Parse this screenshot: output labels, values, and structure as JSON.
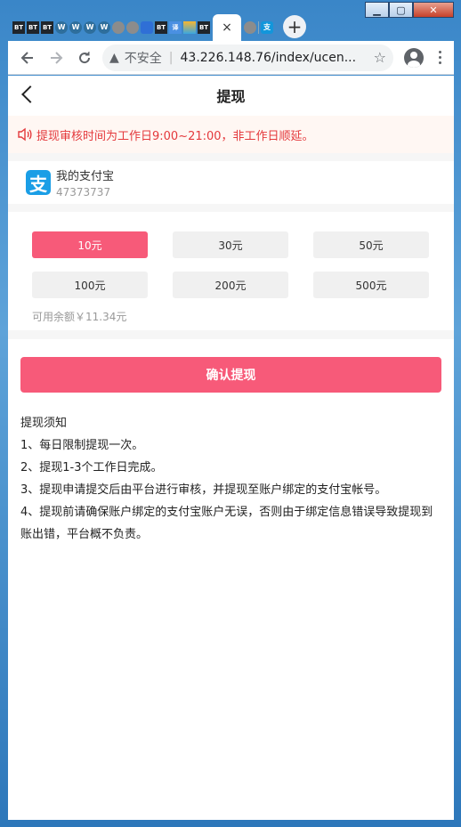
{
  "window": {
    "minimize_glyph": "▁",
    "maximize_glyph": "▢",
    "close_glyph": "✕"
  },
  "tabs": {
    "favicons": [
      {
        "name": "bt-favicon",
        "text": "BT"
      },
      {
        "name": "bt-favicon",
        "text": "BT"
      },
      {
        "name": "bt-favicon",
        "text": "BT"
      },
      {
        "name": "wordpress-favicon",
        "text": "W"
      },
      {
        "name": "wordpress-favicon",
        "text": "W"
      },
      {
        "name": "wordpress-favicon",
        "text": "W"
      },
      {
        "name": "wordpress-favicon",
        "text": "W"
      },
      {
        "name": "globe-favicon",
        "text": ""
      },
      {
        "name": "globe-favicon",
        "text": ""
      },
      {
        "name": "baidu-favicon",
        "text": ""
      },
      {
        "name": "bt-favicon",
        "text": "BT"
      },
      {
        "name": "translate-favicon",
        "text": "译"
      },
      {
        "name": "stack-favicon",
        "text": ""
      },
      {
        "name": "bt-favicon",
        "text": "BT"
      }
    ],
    "active_close": "×",
    "new_tab": "+"
  },
  "toolbar": {
    "security_label": "不安全",
    "url": "43.226.148.76/index/ucen..."
  },
  "page": {
    "title": "提现",
    "notice": "提现审核时间为工作日9:00~21:00，非工作日顺延。",
    "account": {
      "logo_text": "支",
      "name": "我的支付宝",
      "number": "47373737"
    },
    "amounts": [
      "10元",
      "30元",
      "50元",
      "100元",
      "200元",
      "500元"
    ],
    "selected_amount_index": 0,
    "balance_label": "可用余额",
    "balance_value": "￥11.34元",
    "confirm_label": "确认提现",
    "rules": [
      "提现须知",
      "1、每日限制提现一次。",
      "2、提现1-3个工作日完成。",
      "3、提现申请提交后由平台进行审核，并提现至账户绑定的支付宝帐号。",
      "4、提现前请确保账户绑定的支付宝账户无误，否则由于绑定信息错误导致提现到账出错，平台概不负责。"
    ]
  },
  "colors": {
    "accent": "#f75a79",
    "notice_text": "#e4393c",
    "notice_bg": "#fff7f3",
    "alipay_blue": "#1a9ee6"
  }
}
